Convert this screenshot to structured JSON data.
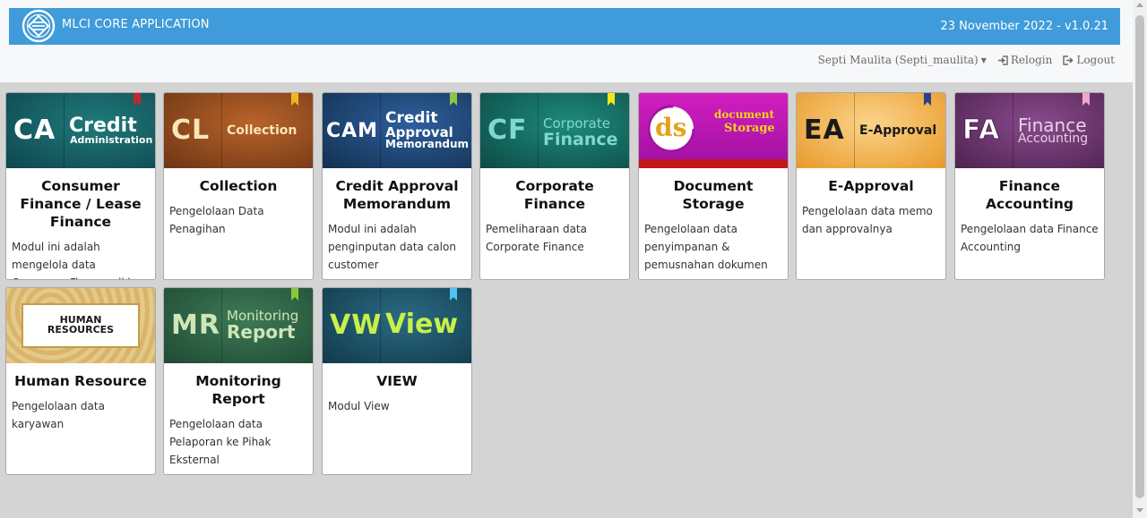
{
  "header": {
    "app_title": "MLCI CORE APPLICATION",
    "date_version": "23 November 2022 - v1.0.21",
    "user": "Septi Maulita (Septi_maulita)",
    "relogin": "Relogin",
    "logout": "Logout"
  },
  "modules": [
    {
      "abbr": "CA",
      "thumb_line1": "Credit",
      "thumb_line2": "Administration",
      "title": "Consumer Finance / Lease Finance",
      "desc": "Modul ini adalah mengelola data Consumer Finance dkk",
      "bookmark": "#c6262b"
    },
    {
      "abbr": "CL",
      "thumb_line1": "Collection",
      "thumb_line2": "",
      "title": "Collection",
      "desc": "Pengelolaan Data Penagihan",
      "bookmark": "#f2b51c"
    },
    {
      "abbr": "CAM",
      "thumb_line1": "Credit",
      "thumb_line2": "Approval",
      "thumb_line3": "Memorandum",
      "title": "Credit Approval Memorandum",
      "desc": "Modul ini adalah penginputan data calon customer",
      "bookmark": "#8cc63f"
    },
    {
      "abbr": "CF",
      "thumb_line1": "Corporate",
      "thumb_line2": "Finance",
      "title": "Corporate Finance",
      "desc": "Pemeliharaan data Corporate Finance",
      "bookmark": "#f5e61c"
    },
    {
      "abbr": "ds",
      "thumb_line1": "document",
      "thumb_line2": "Storage",
      "title": "Document Storage",
      "desc": "Pengelolaan data penyimpanan & pemusnahan dokumen",
      "bookmark": ""
    },
    {
      "abbr": "EA",
      "thumb_line1": "E-Approval",
      "thumb_line2": "",
      "title": "E-Approval",
      "desc": "Pengelolaan data memo dan approvalnya",
      "bookmark": "#2b3f8a"
    },
    {
      "abbr": "FA",
      "thumb_line1": "Finance",
      "thumb_line2": "Accounting",
      "title": "Finance Accounting",
      "desc": "Pengelolaan data Finance Accounting",
      "bookmark": "#f4a6c8"
    },
    {
      "abbr": "",
      "thumb_line1": "HUMAN",
      "thumb_line2": "RESOURCES",
      "title": "Human Resource",
      "desc": "Pengelolaan data karyawan",
      "bookmark": ""
    },
    {
      "abbr": "MR",
      "thumb_line1": "Monitoring",
      "thumb_line2": "Report",
      "title": "Monitoring Report",
      "desc": "Pengelolaan data Pelaporan ke Pihak Eksternal",
      "bookmark": "#8cc63f"
    },
    {
      "abbr": "VW",
      "thumb_line1": "View",
      "thumb_line2": "",
      "title": "VIEW",
      "desc": "Modul View",
      "bookmark": "#4fc3f7"
    }
  ],
  "colors": {
    "banner": "#3f9bd9",
    "background": "#d4d4d4"
  }
}
